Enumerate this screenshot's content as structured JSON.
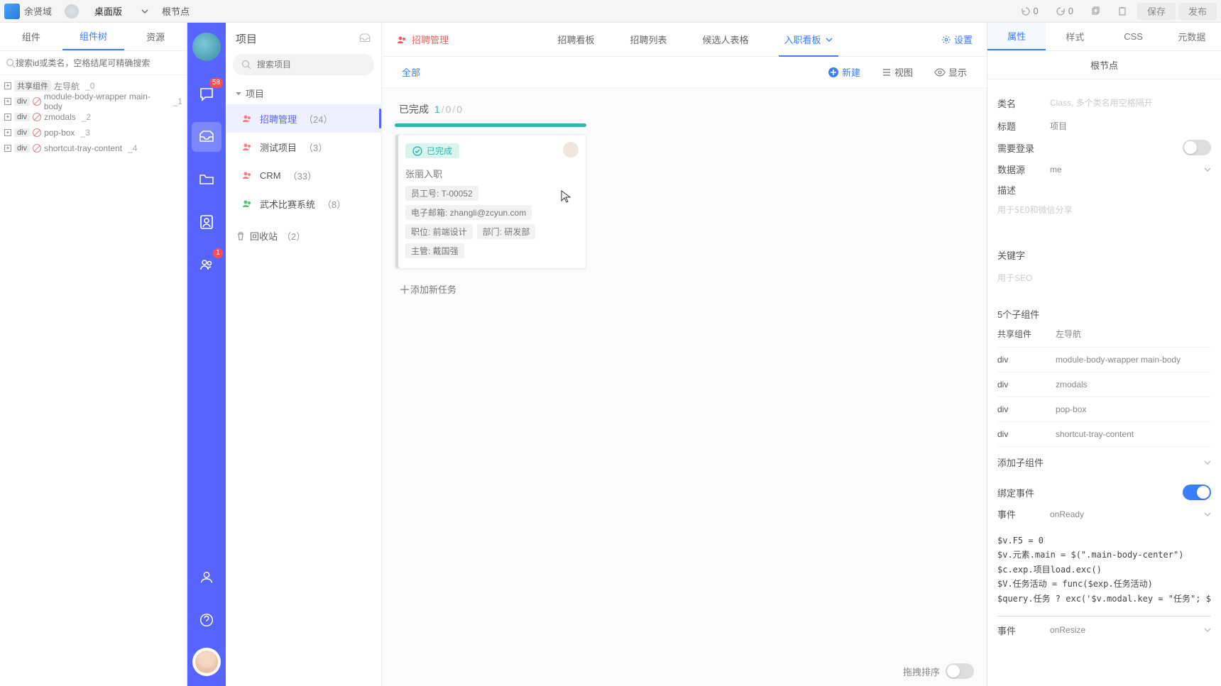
{
  "topbar": {
    "username": "余贤域",
    "mode": "桌面版",
    "breadcrumb": "根节点",
    "undo_count": "0",
    "redo_count": "0",
    "save": "保存",
    "publish": "发布"
  },
  "left_tabs": {
    "t1": "组件",
    "t2": "组件树",
    "t3": "资源"
  },
  "left_search_ph": "搜索id或类名，空格结尾可精确搜索",
  "tree": [
    {
      "kind": "共享组件",
      "name": "左导航",
      "idx": "_0"
    },
    {
      "kind": "div",
      "name": "module-body-wrapper main-body",
      "idx": "_1",
      "slash": true
    },
    {
      "kind": "div",
      "name": "zmodals",
      "idx": "_2",
      "slash": true
    },
    {
      "kind": "div",
      "name": "pop-box",
      "idx": "_3",
      "slash": true
    },
    {
      "kind": "div",
      "name": "shortcut-tray-content",
      "idx": "_4",
      "slash": true
    }
  ],
  "rail": {
    "chat_badge": "58",
    "person_badge": "1"
  },
  "projcol": {
    "title": "项目",
    "search_ph": "搜索项目",
    "section": "项目",
    "items": [
      {
        "label": "招聘管理",
        "count": "（24）",
        "icon": "r"
      },
      {
        "label": "测试项目",
        "count": "（3）",
        "icon": "r"
      },
      {
        "label": "CRM",
        "count": "（33）",
        "icon": "r"
      },
      {
        "label": "武术比赛系统",
        "count": "（8）",
        "icon": "g"
      }
    ],
    "recycle": "回收站",
    "recycle_count": "（2）"
  },
  "center": {
    "tabs": {
      "title": "招聘管理",
      "t1": "招聘看板",
      "t2": "招聘列表",
      "t3": "候选人表格",
      "t4": "入职看板",
      "settings": "设置"
    },
    "sub": {
      "all": "全部",
      "new": "新建",
      "view": "视图",
      "show": "显示"
    },
    "column": {
      "name": "已完成",
      "done": "1",
      "z1": "0",
      "z2": "0",
      "card": {
        "status": "已完成",
        "title": "张丽入职",
        "chips": [
          "员工号: T-00052",
          "电子邮箱: zhangli@zcyun.com",
          "职位: 前端设计",
          "部门: 研发部",
          "主管: 戴国强"
        ]
      },
      "add": "添加新任务"
    },
    "drag_label": "拖拽排序"
  },
  "rpanel": {
    "tabs": {
      "t1": "属性",
      "t2": "样式",
      "t3": "CSS",
      "t4": "元数据"
    },
    "node": "根节点",
    "rows": {
      "class_lbl": "类名",
      "class_ph": "Class, 多个类名用空格隔开",
      "title_lbl": "标题",
      "title_val": "项目",
      "login_lbl": "需要登录",
      "ds_lbl": "数据源",
      "ds_val": "me",
      "desc_lbl": "描述",
      "desc_ph": "用于SEO和微信分享",
      "kw_lbl": "关键字",
      "kw_ph": "用于SEO",
      "sub5": "5个子组件",
      "shared_k": "共享组件",
      "shared_v": "左导航",
      "comps": [
        {
          "k": "div",
          "v": "module-body-wrapper main-body"
        },
        {
          "k": "div",
          "v": "zmodals"
        },
        {
          "k": "div",
          "v": "pop-box"
        },
        {
          "k": "div",
          "v": "shortcut-tray-content"
        }
      ],
      "add_sub": "添加子组件",
      "bind_lbl": "绑定事件",
      "ev1_lbl": "事件",
      "ev1_val": "onReady",
      "code": "$v.F5 = 0\n$v.元素.main = $(\".main-body-center\")\n$c.exp.项目load.exc()\n$V.任务活动 = func($exp.任务活动)\n$query.任务 ? exc('$v.modal.key = \"任务\"; $v.任务_id",
      "ev2_lbl": "事件",
      "ev2_val": "onResize"
    }
  }
}
